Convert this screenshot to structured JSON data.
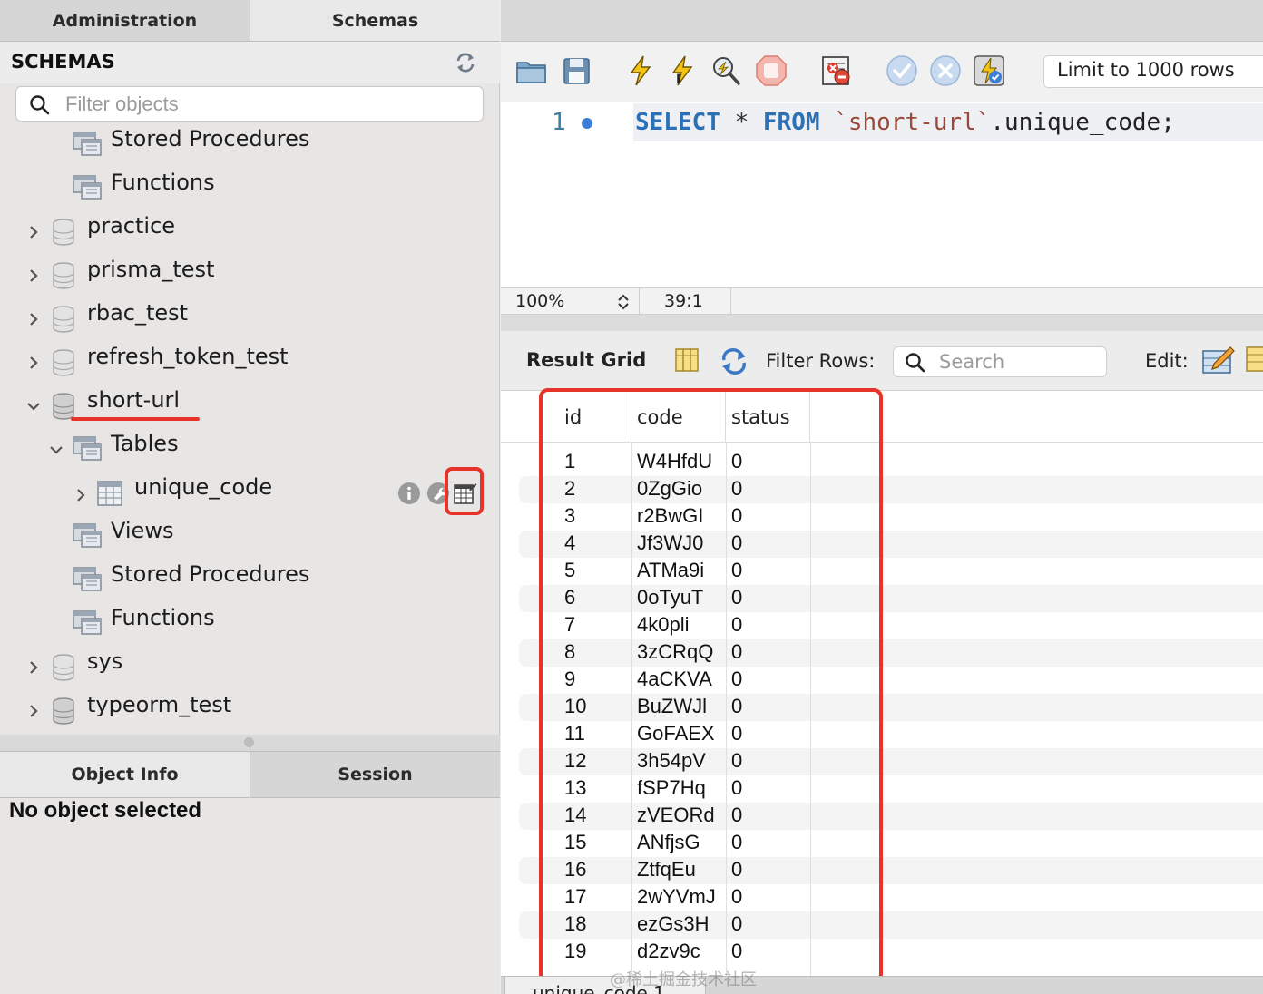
{
  "left_tabs": {
    "administration": "Administration",
    "schemas": "Schemas"
  },
  "schemas_panel": {
    "title": "SCHEMAS",
    "filter_placeholder": "Filter objects",
    "tree": [
      {
        "label": "Stored Procedures",
        "kind": "folder",
        "level": 1
      },
      {
        "label": "Functions",
        "kind": "folder",
        "level": 1
      },
      {
        "label": "practice",
        "kind": "schema",
        "expanded": false
      },
      {
        "label": "prisma_test",
        "kind": "schema",
        "expanded": false
      },
      {
        "label": "rbac_test",
        "kind": "schema",
        "expanded": false
      },
      {
        "label": "refresh_token_test",
        "kind": "schema",
        "expanded": false
      },
      {
        "label": "short-url",
        "kind": "schema",
        "expanded": true
      },
      {
        "label": "Tables",
        "kind": "folder",
        "level": 1,
        "expanded": true
      },
      {
        "label": "unique_code",
        "kind": "table",
        "level": 2,
        "expanded": false
      },
      {
        "label": "Views",
        "kind": "folder",
        "level": 1
      },
      {
        "label": "Stored Procedures",
        "kind": "folder",
        "level": 1
      },
      {
        "label": "Functions",
        "kind": "folder",
        "level": 1
      },
      {
        "label": "sys",
        "kind": "schema",
        "expanded": false
      },
      {
        "label": "typeorm_test",
        "kind": "schema",
        "expanded": false
      }
    ]
  },
  "bottom_tabs": {
    "object_info": "Object Info",
    "session": "Session"
  },
  "object_info": {
    "message": "No object selected"
  },
  "toolbar": {
    "icons": [
      "open-folder-icon",
      "save-icon",
      "execute-icon",
      "execute-current-icon",
      "explain-icon",
      "stop-icon",
      "toggle-error-icon",
      "commit-icon",
      "rollback-icon",
      "autocommit-icon"
    ],
    "limit": "Limit to 1000 rows"
  },
  "editor": {
    "line_number": "1",
    "code": {
      "kw1": "SELECT",
      "op": " * ",
      "kw2": "FROM",
      "sp": " ",
      "str": "`short-url`",
      "rest": ".unique_code;"
    }
  },
  "status": {
    "zoom": "100%",
    "cursor": "39:1"
  },
  "result": {
    "title": "Result Grid",
    "filter_label": "Filter Rows:",
    "search_placeholder": "Search",
    "edit_label": "Edit:",
    "columns": [
      "id",
      "code",
      "status"
    ],
    "rows": [
      [
        "1",
        "W4HfdU",
        "0"
      ],
      [
        "2",
        "0ZgGio",
        "0"
      ],
      [
        "3",
        "r2BwGI",
        "0"
      ],
      [
        "4",
        "Jf3WJ0",
        "0"
      ],
      [
        "5",
        "ATMa9i",
        "0"
      ],
      [
        "6",
        "0oTyuT",
        "0"
      ],
      [
        "7",
        "4k0pli",
        "0"
      ],
      [
        "8",
        "3zCRqQ",
        "0"
      ],
      [
        "9",
        "4aCKVA",
        "0"
      ],
      [
        "10",
        "BuZWJl",
        "0"
      ],
      [
        "11",
        "GoFAEX",
        "0"
      ],
      [
        "12",
        "3h54pV",
        "0"
      ],
      [
        "13",
        "fSP7Hq",
        "0"
      ],
      [
        "14",
        "zVEORd",
        "0"
      ],
      [
        "15",
        "ANfjsG",
        "0"
      ],
      [
        "16",
        "ZtfqEu",
        "0"
      ],
      [
        "17",
        "2wYVmJ",
        "0"
      ],
      [
        "18",
        "ezGs3H",
        "0"
      ],
      [
        "19",
        "d2zv9c",
        "0"
      ]
    ],
    "result_tab": "unique_code 1"
  },
  "watermark": "@稀土掘金技术社区",
  "colors": {
    "highlight": "#e8332a",
    "keyword": "#2b71b8",
    "string": "#9a4a3a"
  }
}
